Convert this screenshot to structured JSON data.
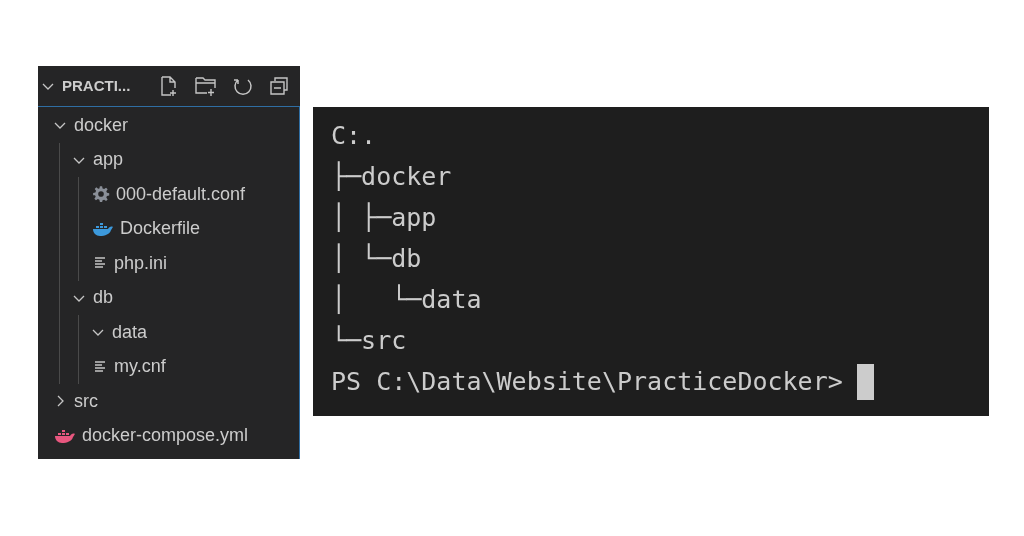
{
  "explorer": {
    "title": "PRACTI...",
    "expanded": true,
    "tree": [
      {
        "kind": "folder",
        "name": "docker",
        "expanded": true,
        "children": [
          {
            "kind": "folder",
            "name": "app",
            "expanded": true,
            "children": [
              {
                "kind": "config",
                "name": "000-default.conf"
              },
              {
                "kind": "docker",
                "name": "Dockerfile",
                "color": "#3c99dc"
              },
              {
                "kind": "text",
                "name": "php.ini"
              }
            ]
          },
          {
            "kind": "folder",
            "name": "db",
            "expanded": true,
            "children": [
              {
                "kind": "folder",
                "name": "data",
                "expanded": true
              },
              {
                "kind": "text",
                "name": "my.cnf"
              }
            ]
          }
        ]
      },
      {
        "kind": "folder",
        "name": "src",
        "expanded": false
      },
      {
        "kind": "docker",
        "name": "docker-compose.yml",
        "color": "#e8577f"
      }
    ]
  },
  "terminal": {
    "lines": [
      "C:.",
      "├─docker",
      "│ ├─app",
      "│ └─db",
      "│   └─data",
      "└─src"
    ],
    "prompt": "PS C:\\Data\\Website\\PracticeDocker>"
  }
}
